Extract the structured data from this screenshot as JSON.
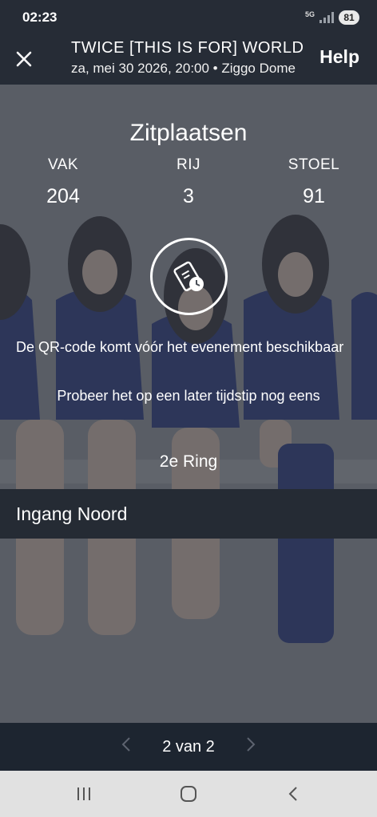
{
  "status_bar": {
    "time": "02:23",
    "network": "5G",
    "battery": "81"
  },
  "header": {
    "title": "TWICE [THIS IS FOR] WORLD TOUR",
    "subtitle": "za, mei 30 2026, 20:00 • Ziggo Dome",
    "help_label": "Help"
  },
  "ticket": {
    "seats_heading": "Zitplaatsen",
    "seats": [
      {
        "label": "VAK",
        "value": "204"
      },
      {
        "label": "RIJ",
        "value": "3"
      },
      {
        "label": "STOEL",
        "value": "91"
      }
    ],
    "qr_message": "De QR-code komt vóór het evenement beschikbaar",
    "qr_retry": "Probeer het op een later tijdstip nog eens",
    "section": "2e Ring",
    "entrance": "Ingang Noord"
  },
  "pager": {
    "text": "2 van 2"
  },
  "icons": {
    "close": "close-icon",
    "ticket_clock": "ticket-clock-icon",
    "prev": "chevron-left-icon",
    "next": "chevron-right-icon"
  },
  "colors": {
    "header_bg": "#262c36",
    "entrance_bg": "#252b34",
    "pager_bg": "#1d2530",
    "navbar_bg": "#e1e1e1"
  }
}
